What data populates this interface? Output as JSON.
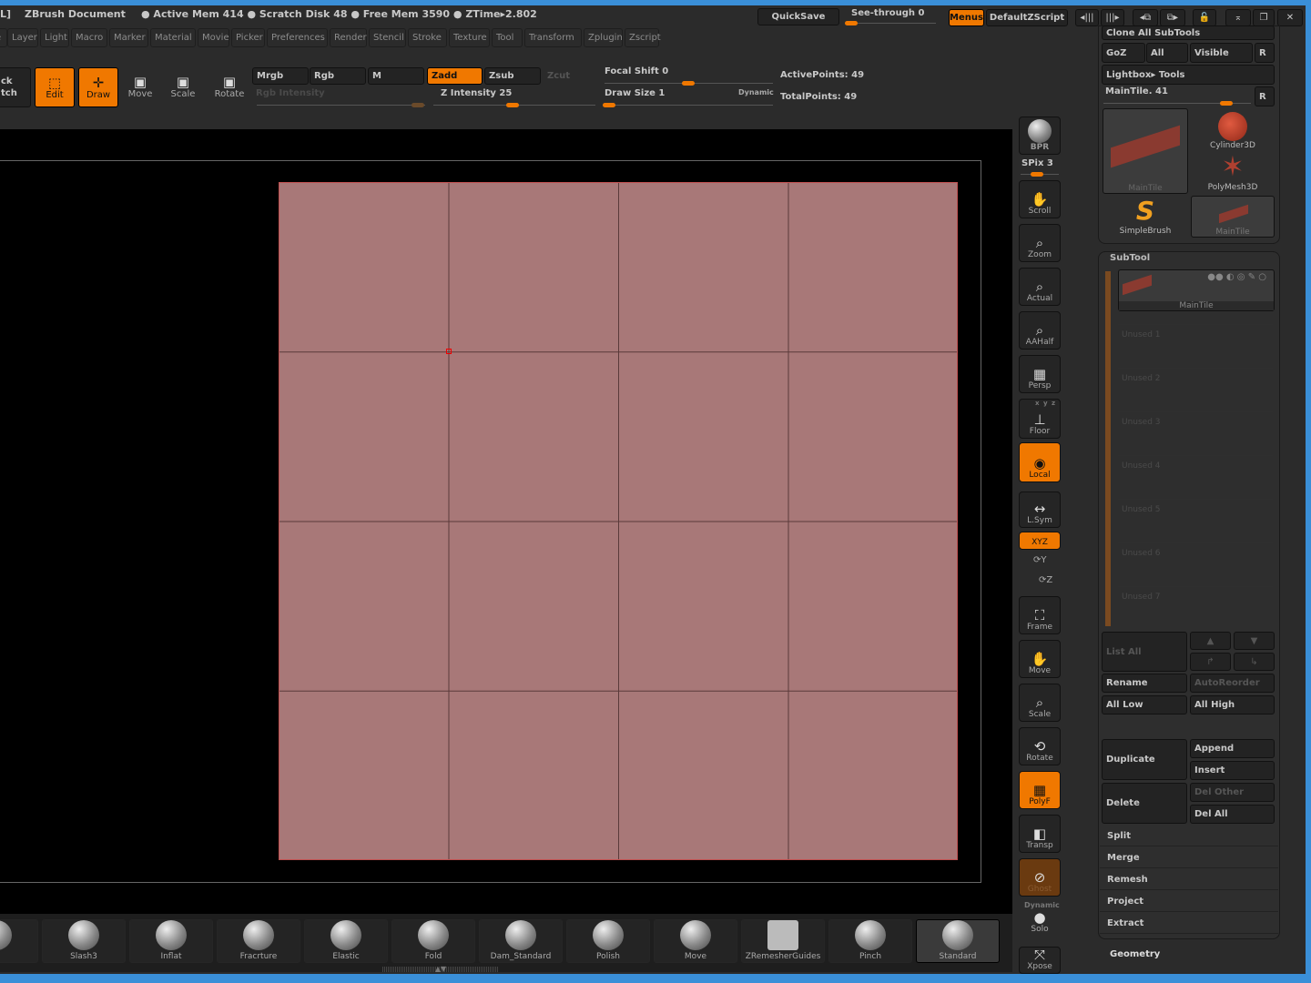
{
  "title_bar": {
    "prefix": "L]",
    "doc": "ZBrush Document",
    "status": "● Active Mem 414 ● Scratch Disk 48 ● Free Mem 3590 ● ZTime▸2.802",
    "quicksave": "QuickSave",
    "see_through": "See-through  0",
    "see_through_value": 0,
    "menus": "Menus",
    "script": "DefaultZScript"
  },
  "menus": [
    "e",
    "Layer",
    "Light",
    "Macro",
    "Marker",
    "Material",
    "Movie",
    "Picker",
    "Preferences",
    "Render",
    "Stencil",
    "Stroke",
    "Texture",
    "Tool",
    "Transform",
    "Zplugin",
    "Zscript"
  ],
  "toolbar": {
    "quick_sketch": "ck\ntch",
    "edit": "Edit",
    "draw": "Draw",
    "move": "Move",
    "scale": "Scale",
    "rotate": "Rotate",
    "mrgb": "Mrgb",
    "rgb": "Rgb",
    "m": "M",
    "zadd": "Zadd",
    "zsub": "Zsub",
    "zcut": "Zcut",
    "rgb_intensity": "Rgb Intensity",
    "z_intensity": "Z Intensity 25",
    "z_intensity_value": 25,
    "focal_shift": "Focal Shift 0",
    "focal_shift_value": 0,
    "draw_size": "Draw Size 1",
    "draw_size_value": 1,
    "dynamic": "Dynamic",
    "active_points": "ActivePoints: 49",
    "total_points": "TotalPoints: 49"
  },
  "shelf": {
    "bpr": "BPR",
    "spix": "SPix 3",
    "spix_value": 3,
    "items": [
      "Scroll",
      "Zoom",
      "Actual",
      "AAHalf",
      "Persp",
      "Floor",
      "Local",
      "L.Sym",
      "XYZ",
      "Frame",
      "Move",
      "Scale",
      "Rotate",
      "PolyF",
      "Transp",
      "Ghost",
      "Solo",
      "Xpose"
    ],
    "dynamic": "Dynamic",
    "floor_axes": "x y z"
  },
  "tool_panel": {
    "clone": "Clone  All  SubTools",
    "goz": "GoZ",
    "all": "All",
    "visible": "Visible",
    "r": "R",
    "lightbox": "Lightbox▸ Tools",
    "maintile": "MainTile. 41",
    "maintile_value": 41,
    "thumbs": [
      "MainTile",
      "Cylinder3D",
      "PolyMesh3D",
      "SimpleBrush",
      "MainTile"
    ]
  },
  "subtool": {
    "title": "SubTool",
    "active": "MainTile",
    "unused": [
      "Unused  1",
      "Unused  2",
      "Unused  3",
      "Unused  4",
      "Unused  5",
      "Unused  6",
      "Unused  7"
    ],
    "list_all": "List  All",
    "rename": "Rename",
    "autoreorder": "AutoReorder",
    "all_low": "All  Low",
    "all_high": "All  High",
    "duplicate": "Duplicate",
    "append": "Append",
    "insert": "Insert",
    "delete": "Delete",
    "del_other": "Del  Other",
    "del_all": "Del  All",
    "rows": [
      "Split",
      "Merge",
      "Remesh",
      "Project",
      "Extract"
    ],
    "geometry": "Geometry"
  },
  "brushes": [
    "y",
    "Slash3",
    "Inflat",
    "Fracrture",
    "Elastic",
    "Fold",
    "Dam_Standard",
    "Polish",
    "Move",
    "ZRemesherGuides",
    "Pinch",
    "Standard"
  ],
  "colors": {
    "accent": "#f07800",
    "plane": "#a87878",
    "frame": "#3a8fd8"
  }
}
